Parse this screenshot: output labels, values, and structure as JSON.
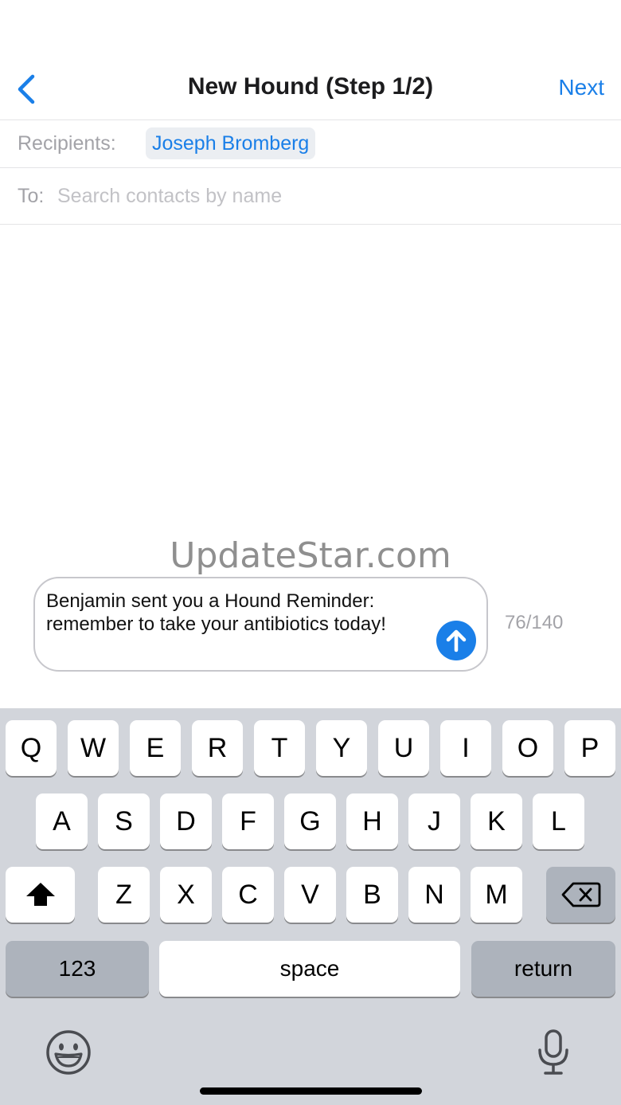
{
  "nav": {
    "title": "New Hound (Step 1/2)",
    "next_label": "Next",
    "back_icon": "chevron-left-icon"
  },
  "recipients": {
    "label": "Recipients:",
    "chips": [
      "Joseph Bromberg"
    ]
  },
  "to_field": {
    "label": "To:",
    "placeholder": "Search contacts by name"
  },
  "watermark": "UpdateStar.com",
  "message": {
    "text": "Benjamin sent you a Hound Reminder: remember to take your antibiotics today!",
    "counter": "76/140",
    "send_icon": "arrow-up-circle-icon"
  },
  "keyboard": {
    "row1": [
      "Q",
      "W",
      "E",
      "R",
      "T",
      "Y",
      "U",
      "I",
      "O",
      "P"
    ],
    "row2": [
      "A",
      "S",
      "D",
      "F",
      "G",
      "H",
      "J",
      "K",
      "L"
    ],
    "row3": [
      "Z",
      "X",
      "C",
      "V",
      "B",
      "N",
      "M"
    ],
    "numbers_label": "123",
    "space_label": "space",
    "return_label": "return",
    "shift_icon": "shift-icon",
    "backspace_icon": "backspace-icon",
    "emoji_icon": "emoji-icon",
    "mic_icon": "microphone-icon"
  },
  "colors": {
    "accent": "#1a7fe8",
    "keyboard_bg": "#d2d5db",
    "dark_key": "#adb3bc"
  }
}
